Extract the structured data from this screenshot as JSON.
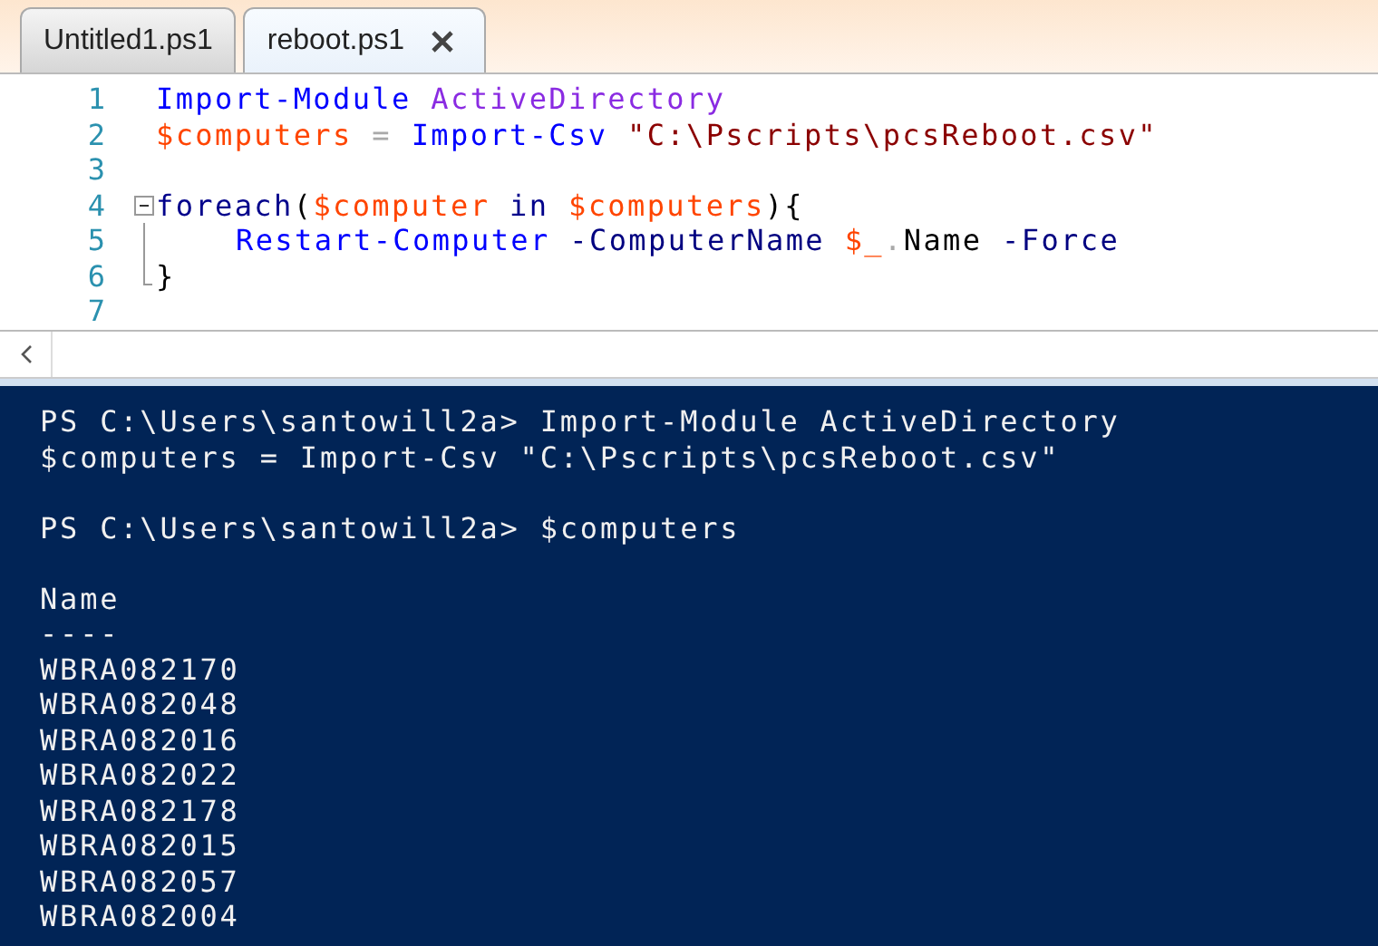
{
  "tabs": [
    {
      "label": "Untitled1.ps1",
      "selected": false
    },
    {
      "label": "reboot.ps1",
      "selected": true
    }
  ],
  "editor": {
    "lines": [
      {
        "number": "1",
        "tokens": [
          {
            "kind": "command",
            "text": "Import-Module "
          },
          {
            "kind": "argument",
            "text": "ActiveDirectory"
          }
        ]
      },
      {
        "number": "2",
        "tokens": [
          {
            "kind": "variable",
            "text": "$computers "
          },
          {
            "kind": "operator",
            "text": "= "
          },
          {
            "kind": "command",
            "text": "Import-Csv "
          },
          {
            "kind": "string",
            "text": "\"C:\\Pscripts\\pcsReboot.csv\""
          }
        ]
      },
      {
        "number": "3"
      },
      {
        "number": "4",
        "expanded": true,
        "tokens": [
          {
            "kind": "keyword",
            "text": "foreach"
          },
          {
            "kind": "plain",
            "text": "("
          },
          {
            "kind": "variable",
            "text": "$computer "
          },
          {
            "kind": "keyword",
            "text": "in "
          },
          {
            "kind": "variable",
            "text": "$computers"
          },
          {
            "kind": "plain",
            "text": "){"
          }
        ],
        "children": [
          {
            "number": "5",
            "tokens": [
              {
                "kind": "command",
                "text": "Restart-Computer "
              },
              {
                "kind": "parameter",
                "text": "-ComputerName "
              },
              {
                "kind": "variable",
                "text": "$_"
              },
              {
                "kind": "operator",
                "text": "."
              },
              {
                "kind": "member",
                "text": "Name "
              },
              {
                "kind": "parameter",
                "text": "-Force"
              }
            ]
          }
        ],
        "end": {
          "number": "6",
          "tokens": [
            {
              "kind": "plain",
              "text": "}"
            }
          ]
        }
      },
      {
        "number": "7"
      }
    ]
  },
  "console": {
    "entries": [
      {
        "kind": "command",
        "prompt": "PS C:\\Users\\santowill2a>",
        "lines": [
          "Import-Module ActiveDirectory",
          "$computers = Import-Csv \"C:\\Pscripts\\pcsReboot.csv\""
        ]
      },
      {
        "kind": "command",
        "prompt": "PS C:\\Users\\santowill2a>",
        "lines": [
          "$computers"
        ]
      },
      {
        "kind": "table",
        "header": "Name",
        "rule": "----",
        "rows": [
          "WBRA082170",
          "WBRA082048",
          "WBRA082016",
          "WBRA082022",
          "WBRA082178",
          "WBRA082015",
          "WBRA082057",
          "WBRA082004"
        ]
      }
    ]
  }
}
